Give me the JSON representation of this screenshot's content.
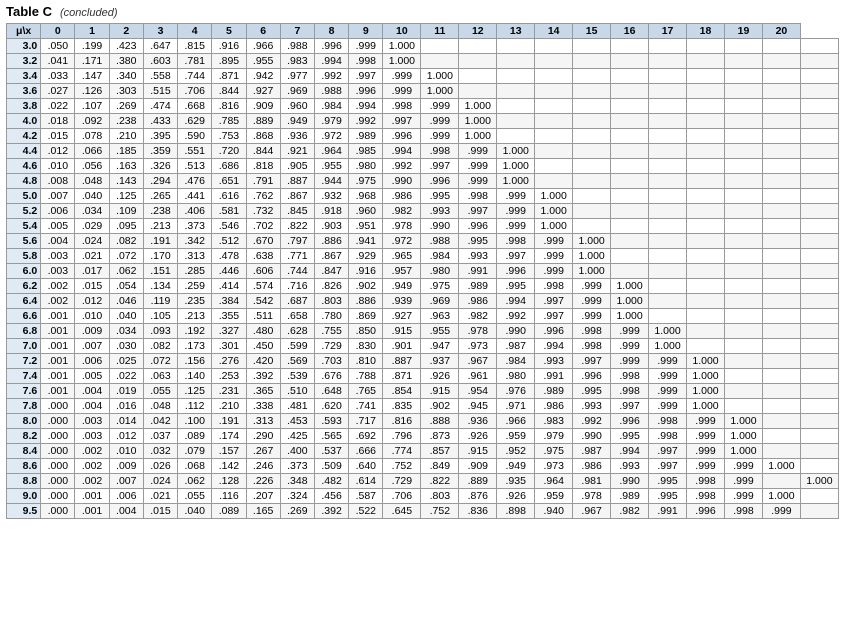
{
  "title": "Table C",
  "subtitle": "(concluded)",
  "col_headers": [
    "μ\\x",
    "0",
    "1",
    "2",
    "3",
    "4",
    "5",
    "6",
    "7",
    "8",
    "9",
    "10",
    "11",
    "12",
    "13",
    "14",
    "15",
    "16",
    "17",
    "18",
    "19",
    "20"
  ],
  "rows": [
    [
      "3.0",
      ".050",
      ".199",
      ".423",
      ".647",
      ".815",
      ".916",
      ".966",
      ".988",
      ".996",
      ".999",
      "1.000",
      "",
      "",
      "",
      "",
      "",
      "",
      "",
      "",
      "",
      "",
      ""
    ],
    [
      "3.2",
      ".041",
      ".171",
      ".380",
      ".603",
      ".781",
      ".895",
      ".955",
      ".983",
      ".994",
      ".998",
      "1.000",
      "",
      "",
      "",
      "",
      "",
      "",
      "",
      "",
      "",
      "",
      ""
    ],
    [
      "3.4",
      ".033",
      ".147",
      ".340",
      ".558",
      ".744",
      ".871",
      ".942",
      ".977",
      ".992",
      ".997",
      ".999",
      "1.000",
      "",
      "",
      "",
      "",
      "",
      "",
      "",
      "",
      "",
      ""
    ],
    [
      "3.6",
      ".027",
      ".126",
      ".303",
      ".515",
      ".706",
      ".844",
      ".927",
      ".969",
      ".988",
      ".996",
      ".999",
      "1.000",
      "",
      "",
      "",
      "",
      "",
      "",
      "",
      "",
      "",
      ""
    ],
    [
      "3.8",
      ".022",
      ".107",
      ".269",
      ".474",
      ".668",
      ".816",
      ".909",
      ".960",
      ".984",
      ".994",
      ".998",
      ".999",
      "1.000",
      "",
      "",
      "",
      "",
      "",
      "",
      "",
      "",
      ""
    ],
    [
      "4.0",
      ".018",
      ".092",
      ".238",
      ".433",
      ".629",
      ".785",
      ".889",
      ".949",
      ".979",
      ".992",
      ".997",
      ".999",
      "1.000",
      "",
      "",
      "",
      "",
      "",
      "",
      "",
      "",
      ""
    ],
    [
      "4.2",
      ".015",
      ".078",
      ".210",
      ".395",
      ".590",
      ".753",
      ".868",
      ".936",
      ".972",
      ".989",
      ".996",
      ".999",
      "1.000",
      "",
      "",
      "",
      "",
      "",
      "",
      "",
      "",
      ""
    ],
    [
      "4.4",
      ".012",
      ".066",
      ".185",
      ".359",
      ".551",
      ".720",
      ".844",
      ".921",
      ".964",
      ".985",
      ".994",
      ".998",
      ".999",
      "1.000",
      "",
      "",
      "",
      "",
      "",
      "",
      "",
      ""
    ],
    [
      "4.6",
      ".010",
      ".056",
      ".163",
      ".326",
      ".513",
      ".686",
      ".818",
      ".905",
      ".955",
      ".980",
      ".992",
      ".997",
      ".999",
      "1.000",
      "",
      "",
      "",
      "",
      "",
      "",
      "",
      ""
    ],
    [
      "4.8",
      ".008",
      ".048",
      ".143",
      ".294",
      ".476",
      ".651",
      ".791",
      ".887",
      ".944",
      ".975",
      ".990",
      ".996",
      ".999",
      "1.000",
      "",
      "",
      "",
      "",
      "",
      "",
      "",
      ""
    ],
    [
      "5.0",
      ".007",
      ".040",
      ".125",
      ".265",
      ".441",
      ".616",
      ".762",
      ".867",
      ".932",
      ".968",
      ".986",
      ".995",
      ".998",
      ".999",
      "1.000",
      "",
      "",
      "",
      "",
      "",
      "",
      ""
    ],
    [
      "5.2",
      ".006",
      ".034",
      ".109",
      ".238",
      ".406",
      ".581",
      ".732",
      ".845",
      ".918",
      ".960",
      ".982",
      ".993",
      ".997",
      ".999",
      "1.000",
      "",
      "",
      "",
      "",
      "",
      "",
      ""
    ],
    [
      "5.4",
      ".005",
      ".029",
      ".095",
      ".213",
      ".373",
      ".546",
      ".702",
      ".822",
      ".903",
      ".951",
      ".978",
      ".990",
      ".996",
      ".999",
      "1.000",
      "",
      "",
      "",
      "",
      "",
      "",
      ""
    ],
    [
      "5.6",
      ".004",
      ".024",
      ".082",
      ".191",
      ".342",
      ".512",
      ".670",
      ".797",
      ".886",
      ".941",
      ".972",
      ".988",
      ".995",
      ".998",
      ".999",
      "1.000",
      "",
      "",
      "",
      "",
      "",
      ""
    ],
    [
      "5.8",
      ".003",
      ".021",
      ".072",
      ".170",
      ".313",
      ".478",
      ".638",
      ".771",
      ".867",
      ".929",
      ".965",
      ".984",
      ".993",
      ".997",
      ".999",
      "1.000",
      "",
      "",
      "",
      "",
      "",
      ""
    ],
    [
      "6.0",
      ".003",
      ".017",
      ".062",
      ".151",
      ".285",
      ".446",
      ".606",
      ".744",
      ".847",
      ".916",
      ".957",
      ".980",
      ".991",
      ".996",
      ".999",
      "1.000",
      "",
      "",
      "",
      "",
      "",
      ""
    ],
    [
      "6.2",
      ".002",
      ".015",
      ".054",
      ".134",
      ".259",
      ".414",
      ".574",
      ".716",
      ".826",
      ".902",
      ".949",
      ".975",
      ".989",
      ".995",
      ".998",
      ".999",
      "1.000",
      "",
      "",
      "",
      "",
      ""
    ],
    [
      "6.4",
      ".002",
      ".012",
      ".046",
      ".119",
      ".235",
      ".384",
      ".542",
      ".687",
      ".803",
      ".886",
      ".939",
      ".969",
      ".986",
      ".994",
      ".997",
      ".999",
      "1.000",
      "",
      "",
      "",
      "",
      ""
    ],
    [
      "6.6",
      ".001",
      ".010",
      ".040",
      ".105",
      ".213",
      ".355",
      ".511",
      ".658",
      ".780",
      ".869",
      ".927",
      ".963",
      ".982",
      ".992",
      ".997",
      ".999",
      "1.000",
      "",
      "",
      "",
      "",
      ""
    ],
    [
      "6.8",
      ".001",
      ".009",
      ".034",
      ".093",
      ".192",
      ".327",
      ".480",
      ".628",
      ".755",
      ".850",
      ".915",
      ".955",
      ".978",
      ".990",
      ".996",
      ".998",
      ".999",
      "1.000",
      "",
      "",
      "",
      ""
    ],
    [
      "7.0",
      ".001",
      ".007",
      ".030",
      ".082",
      ".173",
      ".301",
      ".450",
      ".599",
      ".729",
      ".830",
      ".901",
      ".947",
      ".973",
      ".987",
      ".994",
      ".998",
      ".999",
      "1.000",
      "",
      "",
      "",
      ""
    ],
    [
      "7.2",
      ".001",
      ".006",
      ".025",
      ".072",
      ".156",
      ".276",
      ".420",
      ".569",
      ".703",
      ".810",
      ".887",
      ".937",
      ".967",
      ".984",
      ".993",
      ".997",
      ".999",
      ".999",
      "1.000",
      "",
      "",
      ""
    ],
    [
      "7.4",
      ".001",
      ".005",
      ".022",
      ".063",
      ".140",
      ".253",
      ".392",
      ".539",
      ".676",
      ".788",
      ".871",
      ".926",
      ".961",
      ".980",
      ".991",
      ".996",
      ".998",
      ".999",
      "1.000",
      "",
      "",
      ""
    ],
    [
      "7.6",
      ".001",
      ".004",
      ".019",
      ".055",
      ".125",
      ".231",
      ".365",
      ".510",
      ".648",
      ".765",
      ".854",
      ".915",
      ".954",
      ".976",
      ".989",
      ".995",
      ".998",
      ".999",
      "1.000",
      "",
      "",
      ""
    ],
    [
      "7.8",
      ".000",
      ".004",
      ".016",
      ".048",
      ".112",
      ".210",
      ".338",
      ".481",
      ".620",
      ".741",
      ".835",
      ".902",
      ".945",
      ".971",
      ".986",
      ".993",
      ".997",
      ".999",
      "1.000",
      "",
      "",
      ""
    ],
    [
      "8.0",
      ".000",
      ".003",
      ".014",
      ".042",
      ".100",
      ".191",
      ".313",
      ".453",
      ".593",
      ".717",
      ".816",
      ".888",
      ".936",
      ".966",
      ".983",
      ".992",
      ".996",
      ".998",
      ".999",
      "1.000",
      "",
      ""
    ],
    [
      "8.2",
      ".000",
      ".003",
      ".012",
      ".037",
      ".089",
      ".174",
      ".290",
      ".425",
      ".565",
      ".692",
      ".796",
      ".873",
      ".926",
      ".959",
      ".979",
      ".990",
      ".995",
      ".998",
      ".999",
      "1.000",
      "",
      ""
    ],
    [
      "8.4",
      ".000",
      ".002",
      ".010",
      ".032",
      ".079",
      ".157",
      ".267",
      ".400",
      ".537",
      ".666",
      ".774",
      ".857",
      ".915",
      ".952",
      ".975",
      ".987",
      ".994",
      ".997",
      ".999",
      "1.000",
      "",
      ""
    ],
    [
      "8.6",
      ".000",
      ".002",
      ".009",
      ".026",
      ".068",
      ".142",
      ".246",
      ".373",
      ".509",
      ".640",
      ".752",
      ".849",
      ".909",
      ".949",
      ".973",
      ".986",
      ".993",
      ".997",
      ".999",
      ".999",
      "1.000",
      ""
    ],
    [
      "8.8",
      ".000",
      ".002",
      ".007",
      ".024",
      ".062",
      ".128",
      ".226",
      ".348",
      ".482",
      ".614",
      ".729",
      ".822",
      ".889",
      ".935",
      ".964",
      ".981",
      ".990",
      ".995",
      ".998",
      ".999",
      "",
      "1.000"
    ],
    [
      "9.0",
      ".000",
      ".001",
      ".006",
      ".021",
      ".055",
      ".116",
      ".207",
      ".324",
      ".456",
      ".587",
      ".706",
      ".803",
      ".876",
      ".926",
      ".959",
      ".978",
      ".989",
      ".995",
      ".998",
      ".999",
      "1.000",
      ""
    ],
    [
      "9.5",
      ".000",
      ".001",
      ".004",
      ".015",
      ".040",
      ".089",
      ".165",
      ".269",
      ".392",
      ".522",
      ".645",
      ".752",
      ".836",
      ".898",
      ".940",
      ".967",
      ".982",
      ".991",
      ".996",
      ".998",
      ".999",
      ""
    ]
  ]
}
